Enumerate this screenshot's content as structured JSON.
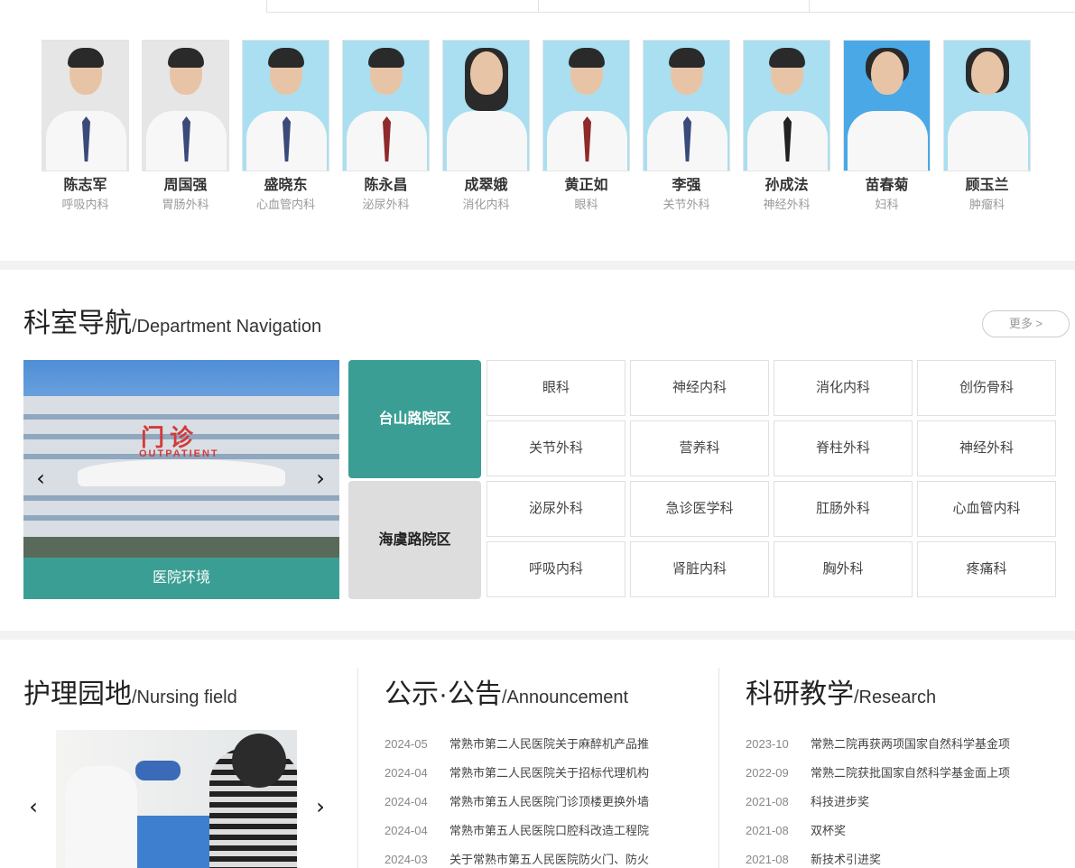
{
  "doctors": [
    {
      "name": "陈志军",
      "dept": "呼吸内科"
    },
    {
      "name": "周国强",
      "dept": "胃肠外科"
    },
    {
      "name": "盛晓东",
      "dept": "心血管内科"
    },
    {
      "name": "陈永昌",
      "dept": "泌尿外科"
    },
    {
      "name": "成翠娥",
      "dept": "消化内科"
    },
    {
      "name": "黄正如",
      "dept": "眼科"
    },
    {
      "name": "李强",
      "dept": "关节外科"
    },
    {
      "name": "孙成法",
      "dept": "神经外科"
    },
    {
      "name": "苗春菊",
      "dept": "妇科"
    },
    {
      "name": "顾玉兰",
      "dept": "肿瘤科"
    }
  ],
  "department_nav": {
    "title_cn": "科室导航",
    "title_en": "/Department Navigation",
    "more": "更多 >",
    "env_caption": "医院环境",
    "env_sign_cn": "门诊",
    "env_sign_en": "OUTPATIENT",
    "campuses": [
      "台山路院区",
      "海虞路院区"
    ],
    "departments": [
      "眼科",
      "神经内科",
      "消化内科",
      "创伤骨科",
      "关节外科",
      "营养科",
      "脊柱外科",
      "神经外科",
      "泌尿外科",
      "急诊医学科",
      "肛肠外科",
      "心血管内科",
      "呼吸内科",
      "肾脏内科",
      "胸外科",
      "疼痛科"
    ]
  },
  "nursing": {
    "title_cn": "护理园地",
    "title_en": "/Nursing field"
  },
  "announcement": {
    "title_cn": "公示·公告",
    "title_en": "/Announcement",
    "items": [
      {
        "date": "2024-05",
        "title": "常熟市第二人民医院关于麻醉机产品推"
      },
      {
        "date": "2024-04",
        "title": "常熟市第二人民医院关于招标代理机构"
      },
      {
        "date": "2024-04",
        "title": "常熟市第五人民医院门诊顶楼更换外墙"
      },
      {
        "date": "2024-04",
        "title": "常熟市第五人民医院口腔科改造工程院"
      },
      {
        "date": "2024-03",
        "title": "关于常熟市第五人民医院防火门、防火"
      }
    ]
  },
  "research": {
    "title_cn": "科研教学",
    "title_en": "/Research",
    "items": [
      {
        "date": "2023-10",
        "title": "常熟二院再获两项国家自然科学基金项"
      },
      {
        "date": "2022-09",
        "title": "常熟二院获批国家自然科学基金面上项"
      },
      {
        "date": "2021-08",
        "title": "科技进步奖"
      },
      {
        "date": "2021-08",
        "title": "双杯奖"
      },
      {
        "date": "2021-08",
        "title": "新技术引进奖"
      }
    ]
  },
  "icons": {
    "prev": "chevron-left-icon",
    "next": "chevron-right-icon"
  },
  "colors": {
    "accent": "#3b9e94",
    "inactive": "#dddddd"
  }
}
